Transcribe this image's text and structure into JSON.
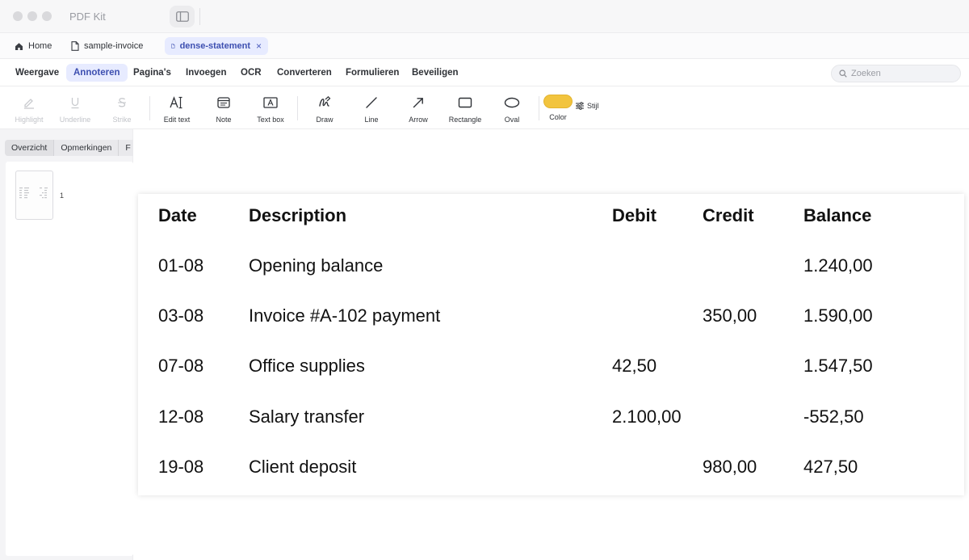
{
  "app": {
    "title": "PDF Kit"
  },
  "tabs": [
    {
      "label": "Home",
      "icon": "home-icon"
    },
    {
      "label": "sample-invoice",
      "icon": "document-icon"
    },
    {
      "label": "dense-statement",
      "icon": "document-icon",
      "active": true,
      "close": "×"
    }
  ],
  "menu": {
    "items": [
      {
        "label": "Weergave"
      },
      {
        "label": "Annoteren",
        "active": true
      },
      {
        "label": "Pagina's"
      },
      {
        "label": "Invoegen"
      },
      {
        "label": "OCR"
      },
      {
        "label": "Converteren"
      },
      {
        "label": "Formulieren"
      },
      {
        "label": "Beveiligen"
      }
    ],
    "search_placeholder": "Zoeken"
  },
  "toolbar": {
    "tools": [
      {
        "label": "Highlight",
        "icon": "highlight-icon",
        "disabled": true
      },
      {
        "label": "Underline",
        "icon": "underline-icon",
        "disabled": true
      },
      {
        "label": "Strike",
        "icon": "strikethrough-icon",
        "disabled": true
      },
      {
        "label": "Edit text",
        "icon": "edit-text-icon"
      },
      {
        "label": "Note",
        "icon": "note-icon"
      },
      {
        "label": "Text box",
        "icon": "text-box-icon"
      },
      {
        "label": "Draw",
        "icon": "draw-icon"
      },
      {
        "label": "Line",
        "icon": "line-icon"
      },
      {
        "label": "Arrow",
        "icon": "arrow-icon"
      },
      {
        "label": "Rectangle",
        "icon": "rectangle-icon"
      },
      {
        "label": "Oval",
        "icon": "oval-icon"
      }
    ],
    "color_label": "Color",
    "color_value": "#f2c43e",
    "style_label": "Stijl"
  },
  "sidebar": {
    "tabs": [
      {
        "label": "Overzicht",
        "active": true
      },
      {
        "label": "Opmerkingen"
      },
      {
        "label": "F"
      }
    ],
    "page_number": "1"
  },
  "statement": {
    "headers": [
      "Date",
      "Description",
      "Debit",
      "Credit",
      "Balance"
    ],
    "rows": [
      [
        "01-08",
        "Opening balance",
        "",
        "",
        "1.240,00"
      ],
      [
        "03-08",
        "Invoice #A-102 payment",
        "",
        "350,00",
        "1.590,00"
      ],
      [
        "07-08",
        "Office supplies",
        "42,50",
        "",
        "1.547,50"
      ],
      [
        "12-08",
        "Salary transfer",
        "2.100,00",
        "",
        "-552,50"
      ],
      [
        "19-08",
        "Client deposit",
        "",
        "980,00",
        "427,50"
      ]
    ]
  }
}
